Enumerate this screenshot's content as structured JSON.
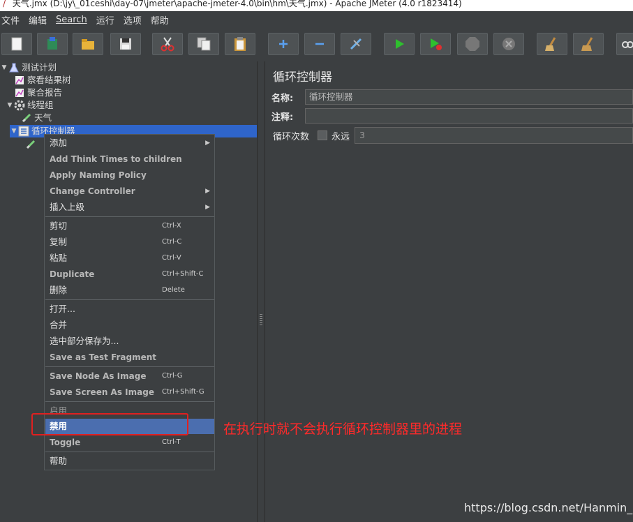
{
  "window": {
    "title": "天气.jmx (D:\\jy\\_01ceshi\\day-07\\jmeter\\apache-jmeter-4.0\\bin\\hm\\天气.jmx) - Apache JMeter (4.0 r1823414)"
  },
  "menubar": {
    "items": [
      "文件",
      "编辑",
      "Search",
      "运行",
      "选项",
      "帮助"
    ]
  },
  "toolbar": {
    "buttons": [
      "new-icon",
      "templates-icon",
      "open-icon",
      "save-icon",
      "cut-icon",
      "copy-icon",
      "paste-icon",
      "expand-icon",
      "collapse-icon",
      "toggle-icon",
      "start-icon",
      "start-no-pause-icon",
      "stop-icon",
      "shutdown-icon",
      "clear-icon",
      "clear-all-icon",
      "search-icon"
    ]
  },
  "tree": {
    "items": [
      {
        "label": "测试计划",
        "icon": "test-plan-icon"
      },
      {
        "label": "察看结果树",
        "icon": "listener-icon"
      },
      {
        "label": "聚合报告",
        "icon": "listener-icon"
      },
      {
        "label": "线程组",
        "icon": "gear-icon"
      },
      {
        "label": "天气",
        "icon": "sampler-icon"
      },
      {
        "label": "循环控制器",
        "icon": "controller-icon"
      }
    ]
  },
  "panel": {
    "title": "循环控制器",
    "name_label": "名称:",
    "name_value": "循环控制器",
    "comment_label": "注释:",
    "comment_value": "",
    "loop_label": "循环次数",
    "forever_label": "永远",
    "loop_value": "3"
  },
  "context_menu": {
    "items": [
      {
        "label": "添加",
        "shortcut": "",
        "submenu": true
      },
      {
        "label": "Add Think Times to children",
        "shortcut": ""
      },
      {
        "label": "Apply Naming Policy",
        "shortcut": ""
      },
      {
        "label": "Change Controller",
        "shortcut": "",
        "submenu": true
      },
      {
        "label": "插入上级",
        "shortcut": "",
        "submenu": true
      },
      {
        "label": "剪切",
        "shortcut": "Ctrl-X"
      },
      {
        "label": "复制",
        "shortcut": "Ctrl-C"
      },
      {
        "label": "粘贴",
        "shortcut": "Ctrl-V"
      },
      {
        "label": "Duplicate",
        "shortcut": "Ctrl+Shift-C"
      },
      {
        "label": "删除",
        "shortcut": "Delete"
      },
      {
        "label": "打开...",
        "shortcut": ""
      },
      {
        "label": "合并",
        "shortcut": ""
      },
      {
        "label": "选中部分保存为...",
        "shortcut": ""
      },
      {
        "label": "Save as Test Fragment",
        "shortcut": ""
      },
      {
        "label": "Save Node As Image",
        "shortcut": "Ctrl-G"
      },
      {
        "label": "Save Screen As Image",
        "shortcut": "Ctrl+Shift-G"
      },
      {
        "label": "启用",
        "shortcut": ""
      },
      {
        "label": "禁用",
        "shortcut": ""
      },
      {
        "label": "Toggle",
        "shortcut": "Ctrl-T"
      },
      {
        "label": "帮助",
        "shortcut": ""
      }
    ]
  },
  "annotation": {
    "text": "在执行时就不会执行循环控制器里的进程",
    "color": "#ff2a2a"
  },
  "watermark": "https://blog.csdn.net/Hanmin_hm",
  "colors": {
    "background": "#3c3f41",
    "selection": "#2f65ca",
    "menu_highlight": "#4b6eaf",
    "annotation": "#e02020"
  }
}
